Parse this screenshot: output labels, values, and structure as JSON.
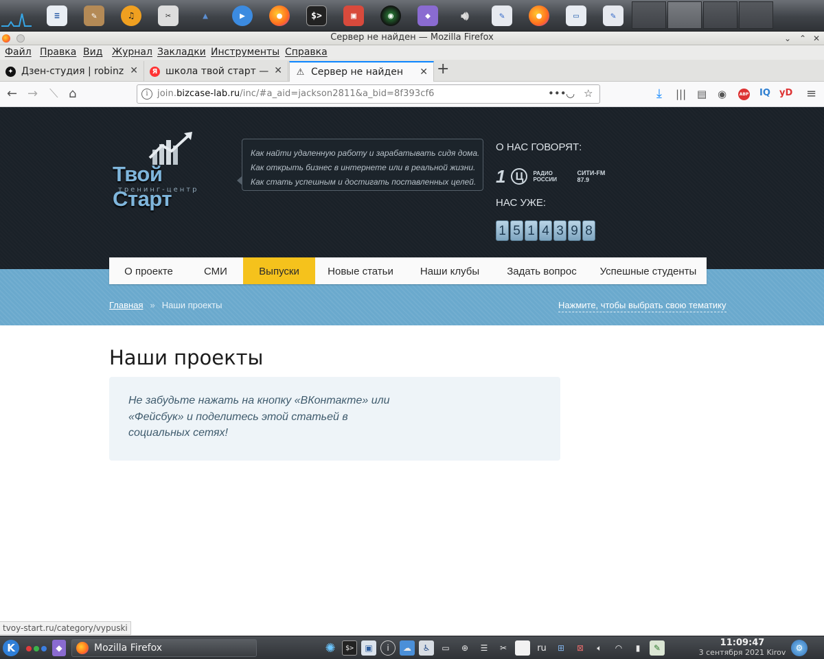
{
  "window": {
    "title": "Сервер не найден — Mozilla Firefox"
  },
  "menu": [
    "Файл",
    "Правка",
    "Вид",
    "Журнал",
    "Закладки",
    "Инструменты",
    "Справка"
  ],
  "tabs": [
    {
      "label": "Дзен-студия | robinzoid",
      "favicon": "zen-icon",
      "active": false
    },
    {
      "label": "школа твой старт — Янде",
      "favicon": "yandex-icon",
      "active": false
    },
    {
      "label": "Сервер не найден",
      "favicon": "warning-icon",
      "active": true
    }
  ],
  "url": {
    "prefix": "join.",
    "domain": "bizcase-lab.ru",
    "path": "/inc/#a_aid=jackson2811&a_bid=8f393cf6"
  },
  "toolbar": {
    "abp_label": "ABP",
    "iq_label": "IQ",
    "yd_label": "yD"
  },
  "site": {
    "logo_word": "Твой Старт",
    "logo_sub": "тренинг-центр",
    "taglines": [
      "Как найти удаленную работу и зарабатывать сидя дома.",
      "Как открыть бизнес в интернете или в реальной жизни.",
      "Как стать успешным и достигать поставленных целей."
    ],
    "about_heading": "О НАС ГОВОРЯТ:",
    "media": [
      "1",
      "Ц",
      "РАДИО РОССИИ",
      "СИТИ-FM 87.9"
    ],
    "counter_heading": "НАС УЖЕ:",
    "counter": [
      "1",
      "5",
      "1",
      "4",
      "3",
      "9",
      "8"
    ],
    "nav": [
      {
        "label": "О проекте",
        "active": false
      },
      {
        "label": "СМИ",
        "active": false
      },
      {
        "label": "Выпуски",
        "active": true
      },
      {
        "label": "Новые статьи",
        "active": false
      },
      {
        "label": "Наши клубы",
        "active": false
      },
      {
        "label": "Задать вопрос",
        "active": false
      },
      {
        "label": "Успешные студенты",
        "active": false
      }
    ],
    "breadcrumb_home": "Главная",
    "breadcrumb_sep": "»",
    "breadcrumb_current": "Наши проекты",
    "topic_link": "Нажмите, чтобы выбрать свою тематику",
    "page_title": "Наши проекты",
    "notice": "Не забудьте нажать на кнопку «ВКонтакте» или «Фейсбук» и поделитесь этой статьей в социальных сетях!"
  },
  "status_url": "tvoy-start.ru/category/vypuski",
  "taskbar": {
    "task_label": "Mozilla Firefox",
    "lang": "ru",
    "time": "11:09:47",
    "date": "3 сентября 2021 Kirov"
  },
  "colors": {
    "accent_nav": "#f5c21c",
    "hero_bg": "#1a2128",
    "band_bg": "#6aa9cd",
    "firefox_blue": "#0a84ff"
  }
}
